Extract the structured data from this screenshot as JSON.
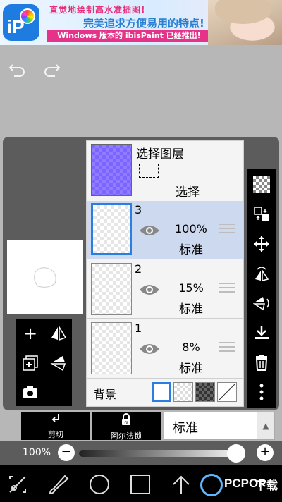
{
  "ad": {
    "line1": "直觉地绘制高水准插图!",
    "line2": "完美追求方便易用的特点!",
    "line3": "Windows 版本的 ibisPaint 已经推出!",
    "logo_text": "iP"
  },
  "toolbar": {
    "undo_icon": "undo-icon",
    "redo_icon": "redo-icon"
  },
  "selection_layer": {
    "title": "选择图层",
    "label": "选择"
  },
  "layers": [
    {
      "number": "3",
      "opacity": "100%",
      "blend": "标准",
      "selected": true
    },
    {
      "number": "2",
      "opacity": "15%",
      "blend": "标准",
      "selected": false
    },
    {
      "number": "1",
      "opacity": "8%",
      "blend": "标准",
      "selected": false
    }
  ],
  "background": {
    "label": "背景"
  },
  "actions": {
    "cut": "剪切",
    "alpha_lock": "阿尔法锁"
  },
  "blend_mode": {
    "value": "标准"
  },
  "opacity_slider": {
    "label": "100%",
    "value": 1.0
  },
  "brand": {
    "text": "PCPOP",
    "suffix": "下载"
  },
  "colors": {
    "selected_row": "#cdd9ef",
    "accent": "#2a7de1",
    "dialog_bg": "#5c5c5c"
  }
}
